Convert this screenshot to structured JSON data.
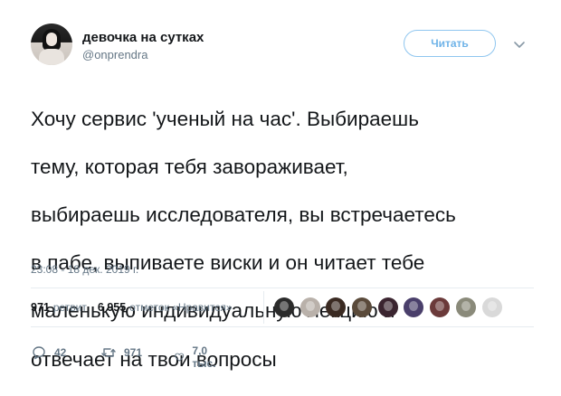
{
  "user": {
    "display_name": "девочка на сутках",
    "handle": "@onprendra"
  },
  "header": {
    "follow_label": "Читать"
  },
  "tweet": {
    "text_lines": [
      "Хочу сервис 'ученый на час'. Выбираешь",
      "тему, которая тебя завораживает,",
      "выбираешь исследователя, вы встречаетесь",
      "в пабе, выпиваете виски и он читает тебе",
      "маленькую индивидуальную лекцию и",
      "отвечает на твои вопросы"
    ],
    "timestamp": "23:08 - 18 дек. 2019 г."
  },
  "stats": {
    "retweets_count": "971",
    "retweets_label": "ретвит",
    "likes_count": "6 955",
    "likes_label": "отметок «Нравится»"
  },
  "likers": [
    {
      "color": "#2b2b2b"
    },
    {
      "color": "#b9b1aa"
    },
    {
      "color": "#3a2a22"
    },
    {
      "color": "#5a4a3a"
    },
    {
      "color": "#3b2530"
    },
    {
      "color": "#4a3f6b"
    },
    {
      "color": "#6b3a3a"
    },
    {
      "color": "#8a8a7a"
    },
    {
      "color": "#d9d9d9"
    }
  ],
  "actions": {
    "replies": "42",
    "retweets": "971",
    "likes": "7,0 тыс."
  },
  "colors": {
    "accent": "#1da1f2",
    "muted": "#657786",
    "text": "#14171a"
  }
}
